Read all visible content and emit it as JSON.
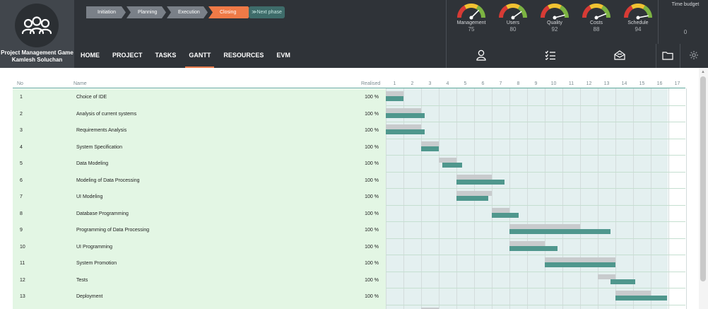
{
  "app": {
    "title": "Project Management Game",
    "user": "Kamlesh Soluchan"
  },
  "phases": [
    {
      "label": "Initiation",
      "color": "#7a8088"
    },
    {
      "label": "Planning",
      "color": "#7a8088"
    },
    {
      "label": "Execution",
      "color": "#7a8088"
    },
    {
      "label": "Closing",
      "color": "#ef7a47"
    }
  ],
  "next_phase": {
    "label": "≫Next phase"
  },
  "gauges": [
    {
      "label": "Management",
      "value": "75",
      "level": 0.75
    },
    {
      "label": "Users",
      "value": "80",
      "level": 0.8
    },
    {
      "label": "Quality",
      "value": "92",
      "level": 0.92
    },
    {
      "label": "Costs",
      "value": "88",
      "level": 0.88
    },
    {
      "label": "Schedule",
      "value": "94",
      "level": 0.94
    }
  ],
  "budget": {
    "label": "Time budget",
    "value": "0"
  },
  "nav": {
    "items": [
      "HOME",
      "PROJECT",
      "TASKS",
      "GANTT",
      "RESOURCES",
      "EVM"
    ],
    "active": "GANTT",
    "icons": [
      "person-icon",
      "checklist-icon",
      "mail-icon",
      "folder-icon",
      "settings-icon"
    ]
  },
  "table": {
    "headers": {
      "no": "No",
      "name": "Name",
      "realised": "Realised"
    },
    "weeks": [
      "1",
      "2",
      "3",
      "4",
      "5",
      "6",
      "7",
      "8",
      "9",
      "10",
      "11",
      "12",
      "13",
      "14",
      "15",
      "16",
      "17"
    ],
    "rows": [
      {
        "no": "1",
        "name": "Choice of IDE",
        "realised": "100 %",
        "plan": [
          1,
          2
        ],
        "real": [
          1,
          2
        ]
      },
      {
        "no": "2",
        "name": "Analysis of current systems",
        "realised": "100 %",
        "plan": [
          1,
          3
        ],
        "real": [
          1,
          3.2
        ]
      },
      {
        "no": "3",
        "name": "Requirements Analysis",
        "realised": "100 %",
        "plan": [
          1,
          3
        ],
        "real": [
          1,
          3.2
        ]
      },
      {
        "no": "4",
        "name": "System Specification",
        "realised": "100 %",
        "plan": [
          3,
          4
        ],
        "real": [
          3,
          4
        ]
      },
      {
        "no": "5",
        "name": "Data Modeling",
        "realised": "100 %",
        "plan": [
          4,
          5
        ],
        "real": [
          4.2,
          5.3
        ]
      },
      {
        "no": "6",
        "name": "Modeling of Data Processing",
        "realised": "100 %",
        "plan": [
          5,
          7
        ],
        "real": [
          5,
          7.7
        ]
      },
      {
        "no": "7",
        "name": "UI Modeling",
        "realised": "100 %",
        "plan": [
          5,
          7
        ],
        "real": [
          5,
          6.8
        ]
      },
      {
        "no": "8",
        "name": "Database Programming",
        "realised": "100 %",
        "plan": [
          7,
          8
        ],
        "real": [
          7,
          8.5
        ]
      },
      {
        "no": "9",
        "name": "Programming of Data Processing",
        "realised": "100 %",
        "plan": [
          8,
          12
        ],
        "real": [
          8,
          13.7
        ]
      },
      {
        "no": "10",
        "name": "UI Programming",
        "realised": "100 %",
        "plan": [
          8,
          10
        ],
        "real": [
          8,
          10.7
        ]
      },
      {
        "no": "11",
        "name": "System Promotion",
        "realised": "100 %",
        "plan": [
          10,
          14
        ],
        "real": [
          10,
          14
        ]
      },
      {
        "no": "12",
        "name": "Tests",
        "realised": "100 %",
        "plan": [
          13,
          14
        ],
        "real": [
          13.7,
          15.1
        ]
      },
      {
        "no": "13",
        "name": "Deployment",
        "realised": "100 %",
        "plan": [
          14,
          16
        ],
        "real": [
          14,
          16.9
        ]
      },
      {
        "no": "",
        "name": "",
        "realised": "",
        "plan": [
          3,
          4
        ],
        "real": null
      }
    ]
  },
  "colors": {
    "header_bg": "#2f3338",
    "accent": "#ef7a47",
    "teal": "#4f978d",
    "plan_gray": "#c8cbcd",
    "row_green": "#e3f6e4"
  }
}
